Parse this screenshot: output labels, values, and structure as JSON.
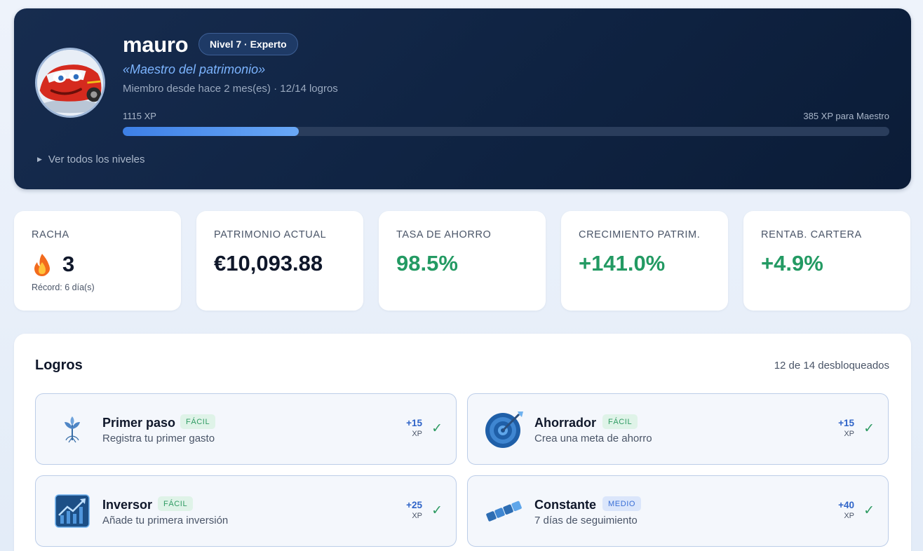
{
  "profile": {
    "username": "mauro",
    "level_badge": "Nivel 7 · Experto",
    "title": "«Maestro del patrimonio»",
    "meta": "Miembro desde hace 2 mes(es) · 12/14 logros",
    "xp_current": "1115 XP",
    "xp_next": "385 XP para Maestro",
    "xp_progress_fraction": 0.23,
    "levels_toggle": "Ver todos los niveles",
    "avatar_icon": "car-avatar"
  },
  "stats": [
    {
      "label": "RACHA",
      "value": "3",
      "sub": "Récord: 6 día(s)",
      "icon": "fire-icon"
    },
    {
      "label": "PATRIMONIO ACTUAL",
      "value": "€10,093.88"
    },
    {
      "label": "TASA DE AHORRO",
      "value": "98.5%"
    },
    {
      "label": "CRECIMIENTO PATRIM.",
      "value": "+141.0%"
    },
    {
      "label": "RENTAB. CARTERA",
      "value": "+4.9%"
    }
  ],
  "achievements": {
    "title": "Logros",
    "count": "12 de 14 desbloqueados",
    "items": [
      {
        "name": "Primer paso",
        "tag": "FÁCIL",
        "desc": "Registra tu primer gasto",
        "xp": "+15",
        "xp_unit": "XP",
        "check": "✓",
        "icon": "sprout-icon"
      },
      {
        "name": "Ahorrador",
        "tag": "FÁCIL",
        "desc": "Crea una meta de ahorro",
        "xp": "+15",
        "xp_unit": "XP",
        "check": "✓",
        "icon": "target-icon"
      },
      {
        "name": "Inversor",
        "tag": "FÁCIL",
        "desc": "Añade tu primera inversión",
        "xp": "+25",
        "xp_unit": "XP",
        "check": "✓",
        "icon": "chart-icon"
      },
      {
        "name": "Constante",
        "tag": "MEDIO",
        "desc": "7 días de seguimiento",
        "xp": "+40",
        "xp_unit": "XP",
        "check": "✓",
        "icon": "chain-icon"
      }
    ]
  },
  "colors": {
    "hero_bg": "#0f2342",
    "accent_blue": "#4a8cf0",
    "positive_green": "#239a63",
    "xp_blue": "#2f64c8"
  }
}
